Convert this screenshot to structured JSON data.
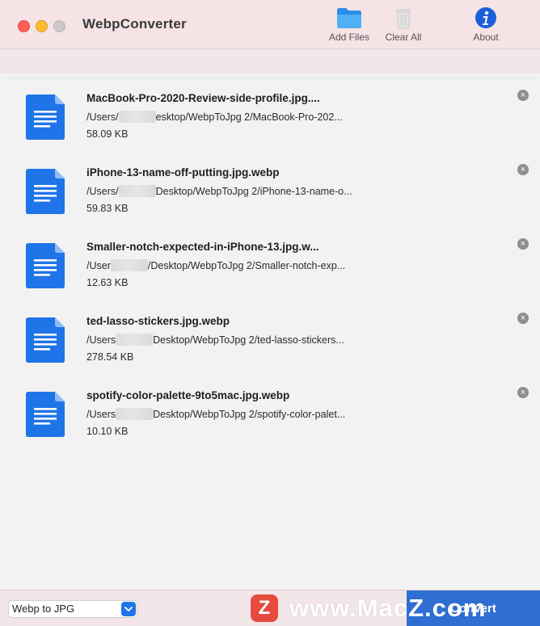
{
  "window": {
    "title": "WebpConverter"
  },
  "toolbar": {
    "add_files_label": "Add Files",
    "clear_all_label": "Clear All",
    "about_label": "About"
  },
  "files": [
    {
      "name": "MacBook-Pro-2020-Review-side-profile.jpg....",
      "path_prefix": "/Users/",
      "path_suffix": "esktop/WebpToJpg 2/MacBook-Pro-202...",
      "size": "58.09 KB"
    },
    {
      "name": "iPhone-13-name-off-putting.jpg.webp",
      "path_prefix": "/Users/",
      "path_suffix": "Desktop/WebpToJpg 2/iPhone-13-name-o...",
      "size": "59.83 KB"
    },
    {
      "name": "Smaller-notch-expected-in-iPhone-13.jpg.w...",
      "path_prefix": "/User",
      "path_suffix": "/Desktop/WebpToJpg 2/Smaller-notch-exp...",
      "size": "12.63 KB"
    },
    {
      "name": "ted-lasso-stickers.jpg.webp",
      "path_prefix": "/Users",
      "path_suffix": "Desktop/WebpToJpg 2/ted-lasso-stickers...",
      "size": "278.54 KB"
    },
    {
      "name": "spotify-color-palette-9to5mac.jpg.webp",
      "path_prefix": "/Users",
      "path_suffix": "Desktop/WebpToJpg 2/spotify-color-palet...",
      "size": "10.10 KB"
    }
  ],
  "bottom": {
    "format_selected": "Webp to JPG",
    "convert_label": "Convert"
  },
  "watermark": {
    "badge": "Z",
    "text": "www.MacZ.com"
  },
  "colors": {
    "toolbar_bg": "#f5e3e6",
    "file_icon_blue": "#1f74e8",
    "convert_blue": "#2f6fd4"
  }
}
